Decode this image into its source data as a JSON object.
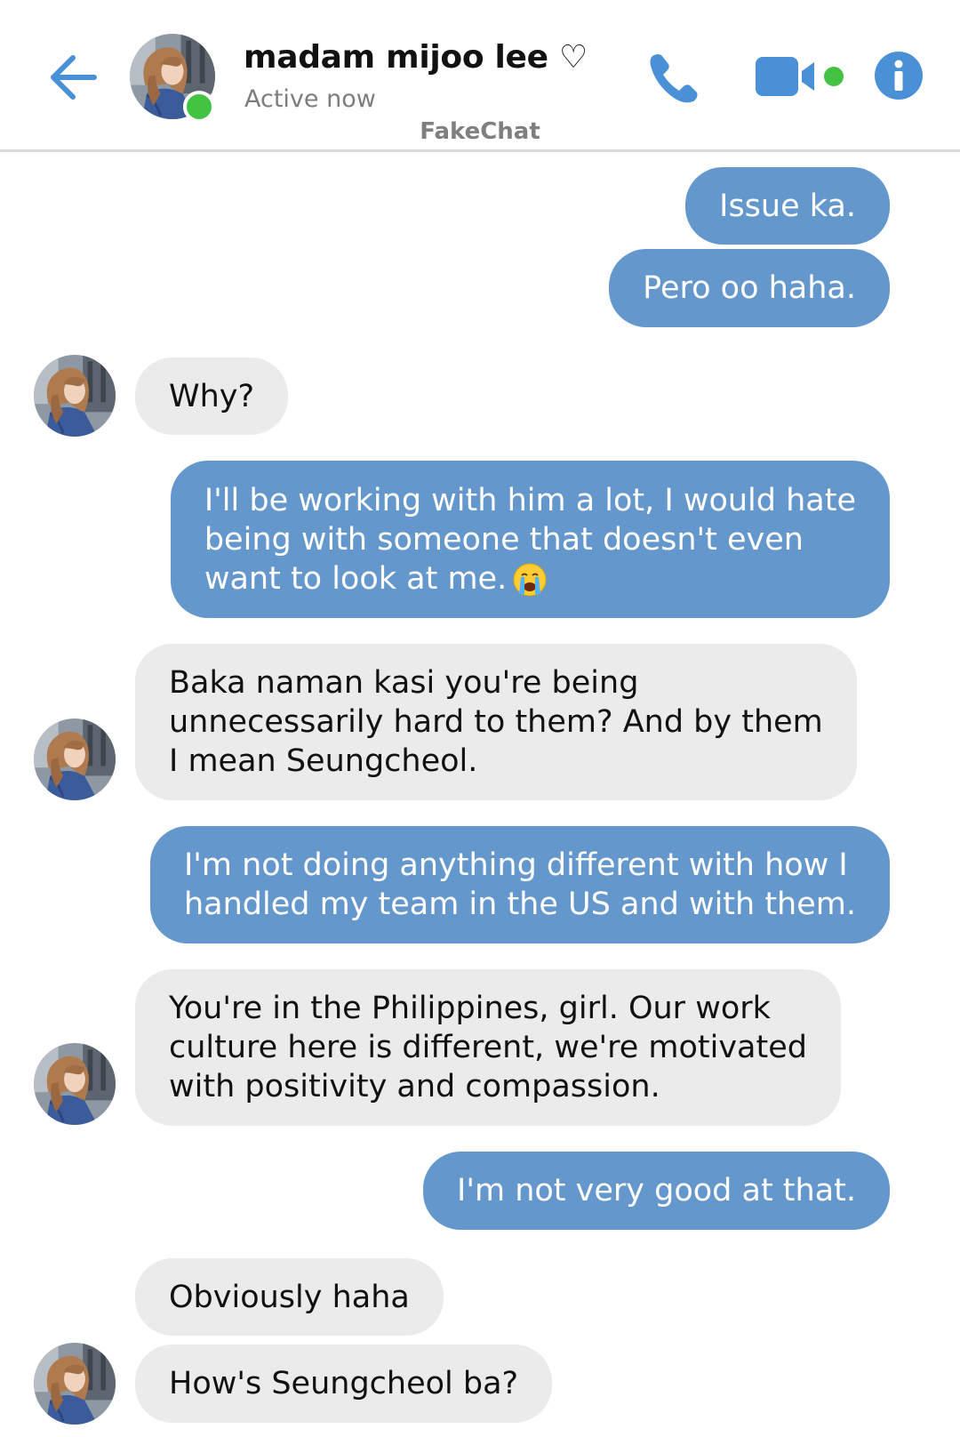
{
  "header": {
    "contact_name": "madam mijoo lee ♡",
    "status": "Active now",
    "watermark": "FakeChat"
  },
  "colors": {
    "accent": "#6497cc",
    "sent_bubble": "#6497cc",
    "received_bubble": "#ebebeb",
    "presence": "#44c242"
  },
  "icons": [
    "arrow-left-icon",
    "phone-icon",
    "video-camera-icon",
    "info-icon",
    "loudly-crying-face-emoji"
  ],
  "messages": [
    {
      "from": "me",
      "lines": [
        "Issue ka."
      ]
    },
    {
      "from": "me",
      "lines": [
        "Pero oo haha."
      ]
    },
    {
      "from": "them",
      "lines": [
        "Why?"
      ]
    },
    {
      "from": "me",
      "lines": [
        "I'll be working with him a lot, I would hate",
        "being with someone that doesn't even",
        "want to look at me."
      ],
      "emoji": "loudly-crying-face"
    },
    {
      "from": "them",
      "lines": [
        "Baka naman kasi you're being",
        "unnecessarily hard to them? And by them",
        "I mean Seungcheol."
      ]
    },
    {
      "from": "me",
      "lines": [
        "I'm not doing anything different with how I",
        "handled my team in the US and with them."
      ]
    },
    {
      "from": "them",
      "lines": [
        "You're in the Philippines, girl. Our work",
        "culture here is different, we're motivated",
        "with positivity and compassion."
      ]
    },
    {
      "from": "me",
      "lines": [
        "I'm not very good at that."
      ]
    },
    {
      "from": "them",
      "lines": [
        "Obviously haha"
      ]
    },
    {
      "from": "them",
      "lines": [
        "How's Seungcheol ba?"
      ]
    }
  ]
}
